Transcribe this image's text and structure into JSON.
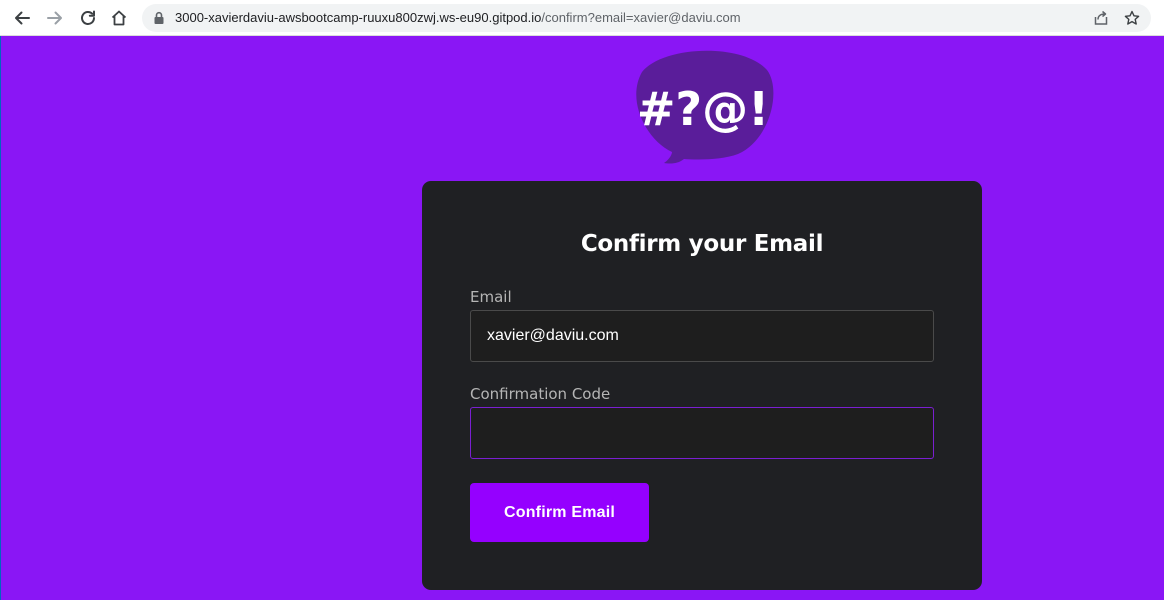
{
  "browser": {
    "url_host": "3000-xavierdaviu-awsbootcamp-ruuxu800zwj.ws-eu90.gitpod.io",
    "url_path": "/confirm?email=xavier@daviu.com",
    "icons": [
      "back-icon",
      "forward-icon",
      "reload-icon",
      "home-icon",
      "lock-icon",
      "share-icon",
      "bookmark-star-icon"
    ]
  },
  "logo": {
    "text": "#?@!"
  },
  "form": {
    "title": "Confirm your Email",
    "email_label": "Email",
    "email_value": "xavier@daviu.com",
    "code_label": "Confirmation Code",
    "code_value": "",
    "submit_label": "Confirm Email"
  },
  "colors": {
    "page_background": "#8a16f5",
    "card_background": "#1f2023",
    "button": "#9500ff",
    "logo_bubble": "#5a1d9a"
  }
}
